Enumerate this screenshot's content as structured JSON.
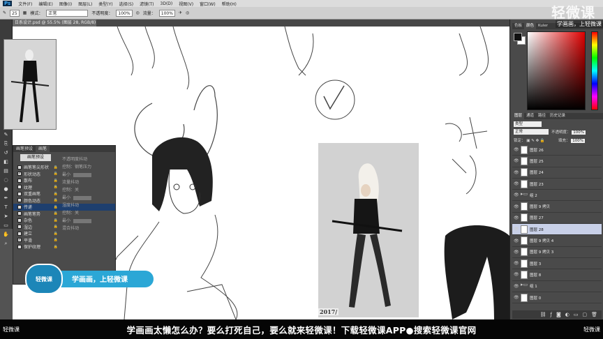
{
  "app": {
    "logo": "Ps"
  },
  "menu": [
    "文件(F)",
    "编辑(E)",
    "图像(I)",
    "图层(L)",
    "类型(Y)",
    "选择(S)",
    "滤镜(T)",
    "3D(D)",
    "视图(V)",
    "窗口(W)",
    "帮助(H)"
  ],
  "options": {
    "brush_size": "25",
    "mode_label": "模式：",
    "mode_value": "正常",
    "opacity_label": "不透明度：",
    "opacity_value": "100%",
    "flow_label": "流量：",
    "flow_value": "100%"
  },
  "document": {
    "tab": "日系设计.psd @ 55.5% (图层 28, RGB/8) *"
  },
  "brush_panel": {
    "tabs": [
      "画笔预设",
      "画笔"
    ],
    "preset_button": "画笔预设",
    "items": [
      {
        "label": "画笔笔尖形状",
        "checked": false
      },
      {
        "label": "形状动态",
        "checked": true
      },
      {
        "label": "散布",
        "checked": false
      },
      {
        "label": "纹理",
        "checked": false
      },
      {
        "label": "双重画笔",
        "checked": false
      },
      {
        "label": "颜色动态",
        "checked": false
      },
      {
        "label": "传递",
        "checked": false,
        "active": true
      },
      {
        "label": "画笔笔势",
        "checked": false
      },
      {
        "label": "杂色",
        "checked": false
      },
      {
        "label": "湿边",
        "checked": false
      },
      {
        "label": "建立",
        "checked": false
      },
      {
        "label": "平滑",
        "checked": true
      },
      {
        "label": "保护纹理",
        "checked": false
      }
    ],
    "right_labels": [
      "不透明度抖动",
      "控制：钢笔压力",
      "最小",
      "流量抖动",
      "控制：关",
      "最小",
      "湿度抖动",
      "控制：关",
      "最小",
      "混合抖动"
    ]
  },
  "color_panel": {
    "tabs": [
      "色板",
      "颜色",
      "Kuler"
    ]
  },
  "layers_panel": {
    "tabs": [
      "图层",
      "通道",
      "路径",
      "历史记录"
    ],
    "kind": "类型",
    "blend_mode": "正常",
    "opacity_label": "不透明度：",
    "opacity_value": "100%",
    "lock_label": "锁定：",
    "fill_label": "填充：",
    "fill_value": "100%",
    "layers": [
      {
        "name": "图层 26",
        "type": "layer",
        "selected": false
      },
      {
        "name": "图层 25",
        "type": "layer",
        "selected": false
      },
      {
        "name": "图层 24",
        "type": "layer",
        "selected": false
      },
      {
        "name": "图层 23",
        "type": "layer",
        "selected": false
      },
      {
        "name": "组 2",
        "type": "folder",
        "selected": false
      },
      {
        "name": "图层 9 拷贝",
        "type": "layer",
        "selected": false
      },
      {
        "name": "图层 27",
        "type": "layer",
        "selected": false
      },
      {
        "name": "图层 28",
        "type": "layer",
        "selected": true
      },
      {
        "name": "图层 9 拷贝 4",
        "type": "layer",
        "selected": false
      },
      {
        "name": "图层 9 拷贝 3",
        "type": "layer",
        "selected": false
      },
      {
        "name": "图层 3",
        "type": "layer",
        "selected": false
      },
      {
        "name": "图层 8",
        "type": "layer",
        "selected": false
      },
      {
        "name": "组 1",
        "type": "folder",
        "selected": false
      },
      {
        "name": "图层 0",
        "type": "layer",
        "selected": false
      }
    ]
  },
  "canvas": {
    "stamp": "2017/"
  },
  "watermark": {
    "brand": "轻微课",
    "slogan": "学画画，上轻微课"
  },
  "badge": {
    "logo": "轻微课",
    "text": "学画画，上轻微课"
  },
  "subtitle": {
    "logo_left": "轻微课",
    "text": "学画画太懒怎么办？要么打死自己，要么就来轻微课！下载轻微课APP●搜索轻微课官网",
    "logo_right": "轻微课"
  }
}
